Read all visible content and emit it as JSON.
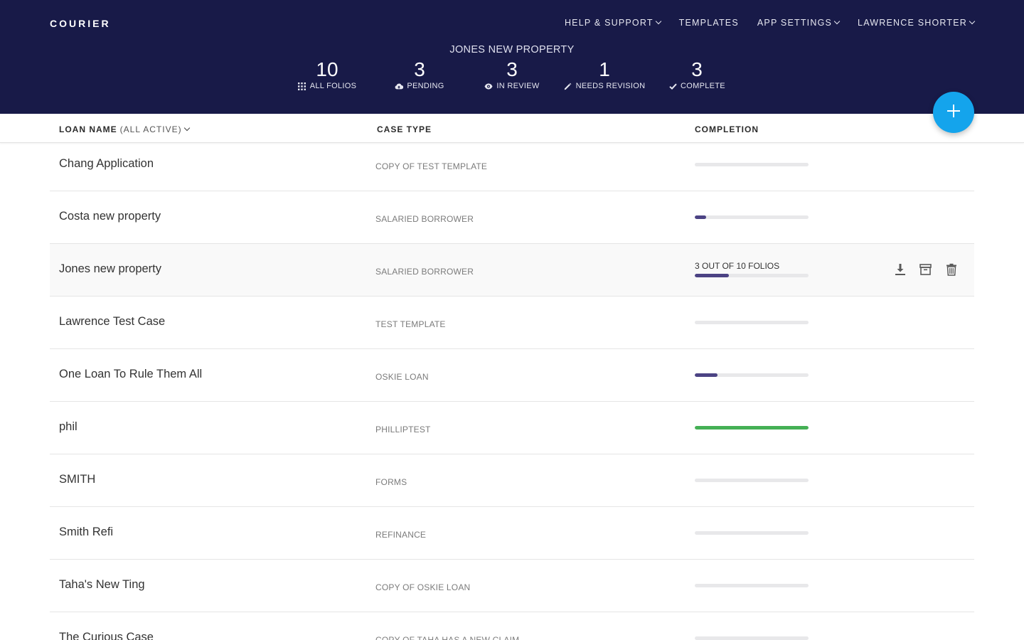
{
  "app": {
    "logo": "COURIER"
  },
  "nav": {
    "items": [
      {
        "label": "HELP & SUPPORT",
        "dropdown": true
      },
      {
        "label": "TEMPLATES",
        "dropdown": false
      },
      {
        "label": "APP SETTINGS",
        "dropdown": true
      },
      {
        "label": "LAWRENCE SHORTER",
        "dropdown": true
      }
    ]
  },
  "case": {
    "title": "JONES NEW PROPERTY"
  },
  "stats": [
    {
      "value": "10",
      "label": "ALL FOLIOS",
      "icon": "grid-icon"
    },
    {
      "value": "3",
      "label": "PENDING",
      "icon": "cloud-upload-icon"
    },
    {
      "value": "3",
      "label": "IN REVIEW",
      "icon": "eye-icon"
    },
    {
      "value": "1",
      "label": "NEEDS REVISION",
      "icon": "pencil-icon"
    },
    {
      "value": "3",
      "label": "COMPLETE",
      "icon": "check-icon"
    }
  ],
  "fab": {
    "icon": "plus-icon"
  },
  "table": {
    "headers": {
      "loan_name": "LOAN NAME",
      "loan_filter": "(ALL ACTIVE)",
      "case_type": "CASE TYPE",
      "completion": "COMPLETION"
    },
    "rows": [
      {
        "name": "Chang Application",
        "type": "COPY OF TEST TEMPLATE",
        "progress": 0
      },
      {
        "name": "Costa new property",
        "type": "SALARIED BORROWER",
        "progress": 0.1
      },
      {
        "name": "Jones new property",
        "type": "SALARIED BORROWER",
        "progress": 0.3,
        "progress_text": "3 OUT OF 10 FOLIOS",
        "active": true
      },
      {
        "name": "Lawrence Test Case",
        "type": "TEST TEMPLATE",
        "progress": 0
      },
      {
        "name": "One Loan To Rule Them All",
        "type": "OSKIE LOAN",
        "progress": 0.2
      },
      {
        "name": "phil",
        "type": "PHILLIPTEST",
        "progress": 1.0
      },
      {
        "name": "SMITH",
        "type": "FORMS",
        "progress": 0
      },
      {
        "name": "Smith Refi",
        "type": "REFINANCE",
        "progress": 0
      },
      {
        "name": "Taha's New Ting",
        "type": "COPY OF OSKIE LOAN",
        "progress": 0
      },
      {
        "name": "The Curious Case",
        "type": "COPY OF TAHA HAS A NEW CLAIM",
        "progress": 0
      }
    ],
    "row_actions": [
      "download-icon",
      "archive-icon",
      "trash-icon"
    ]
  },
  "colors": {
    "header_bg": "#181a48",
    "progress": "#4c4384",
    "progress_complete": "#45b055",
    "fab": "#14a4ec"
  }
}
